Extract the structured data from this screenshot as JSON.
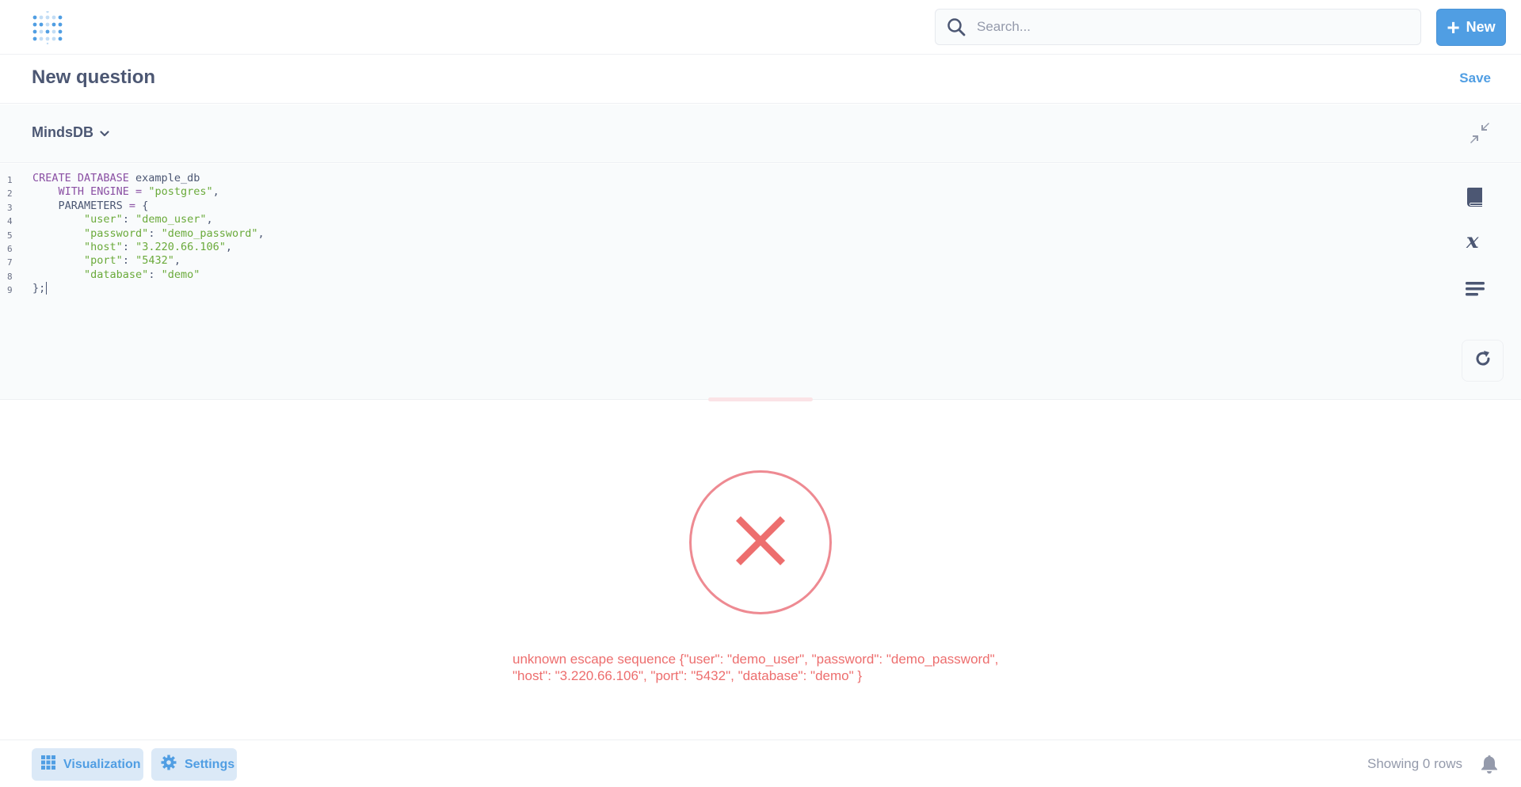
{
  "topbar": {
    "search": {
      "placeholder": "Search..."
    },
    "new_button": "New"
  },
  "question": {
    "title": "New question",
    "save_label": "Save"
  },
  "database": {
    "selected": "MindsDB"
  },
  "editor": {
    "lines": [
      {
        "num": "1",
        "tokens": [
          [
            "kw",
            "CREATE DATABASE"
          ],
          [
            "plain",
            " example_db"
          ]
        ]
      },
      {
        "num": "2",
        "tokens": [
          [
            "plain",
            "    "
          ],
          [
            "kw",
            "WITH ENGINE = "
          ],
          [
            "str",
            "\"postgres\""
          ],
          [
            "plain",
            ","
          ]
        ]
      },
      {
        "num": "3",
        "tokens": [
          [
            "plain",
            "    PARAMETERS "
          ],
          [
            "kw",
            "="
          ],
          [
            "plain",
            " {"
          ]
        ]
      },
      {
        "num": "4",
        "tokens": [
          [
            "plain",
            "        "
          ],
          [
            "str",
            "\"user\""
          ],
          [
            "plain",
            ": "
          ],
          [
            "str",
            "\"demo_user\""
          ],
          [
            "plain",
            ","
          ]
        ]
      },
      {
        "num": "5",
        "tokens": [
          [
            "plain",
            "        "
          ],
          [
            "str",
            "\"password\""
          ],
          [
            "plain",
            ": "
          ],
          [
            "str",
            "\"demo_password\""
          ],
          [
            "plain",
            ","
          ]
        ]
      },
      {
        "num": "6",
        "tokens": [
          [
            "plain",
            "        "
          ],
          [
            "str",
            "\"host\""
          ],
          [
            "plain",
            ": "
          ],
          [
            "str",
            "\"3.220.66.106\""
          ],
          [
            "plain",
            ","
          ]
        ]
      },
      {
        "num": "7",
        "tokens": [
          [
            "plain",
            "        "
          ],
          [
            "str",
            "\"port\""
          ],
          [
            "plain",
            ": "
          ],
          [
            "str",
            "\"5432\""
          ],
          [
            "plain",
            ","
          ]
        ]
      },
      {
        "num": "8",
        "tokens": [
          [
            "plain",
            "        "
          ],
          [
            "str",
            "\"database\""
          ],
          [
            "plain",
            ": "
          ],
          [
            "str",
            "\"demo\""
          ]
        ]
      },
      {
        "num": "9",
        "tokens": [
          [
            "plain",
            "};"
          ]
        ]
      }
    ]
  },
  "error": {
    "line1": "unknown escape sequence {\"user\": \"demo_user\", \"password\": \"demo_password\",",
    "line2": "\"host\": \"3.220.66.106\", \"port\": \"5432\", \"database\": \"demo\" }"
  },
  "footer": {
    "visualization_label": "Visualization",
    "settings_label": "Settings",
    "row_count_text": "Showing 0 rows"
  },
  "colors": {
    "brand": "#509ee3",
    "error": "#ed6e6e",
    "error_ring": "#ee8a92",
    "keyword": "#8a4fa3",
    "string": "#6aaa3a"
  },
  "icons": [
    "metabase-logo-icon",
    "search-icon",
    "plus-icon",
    "chevron-down-icon",
    "collapse-icon",
    "book-icon",
    "variable-icon",
    "snippet-icon",
    "refresh-icon",
    "close-icon",
    "grid-icon",
    "gear-icon",
    "bell-icon"
  ]
}
